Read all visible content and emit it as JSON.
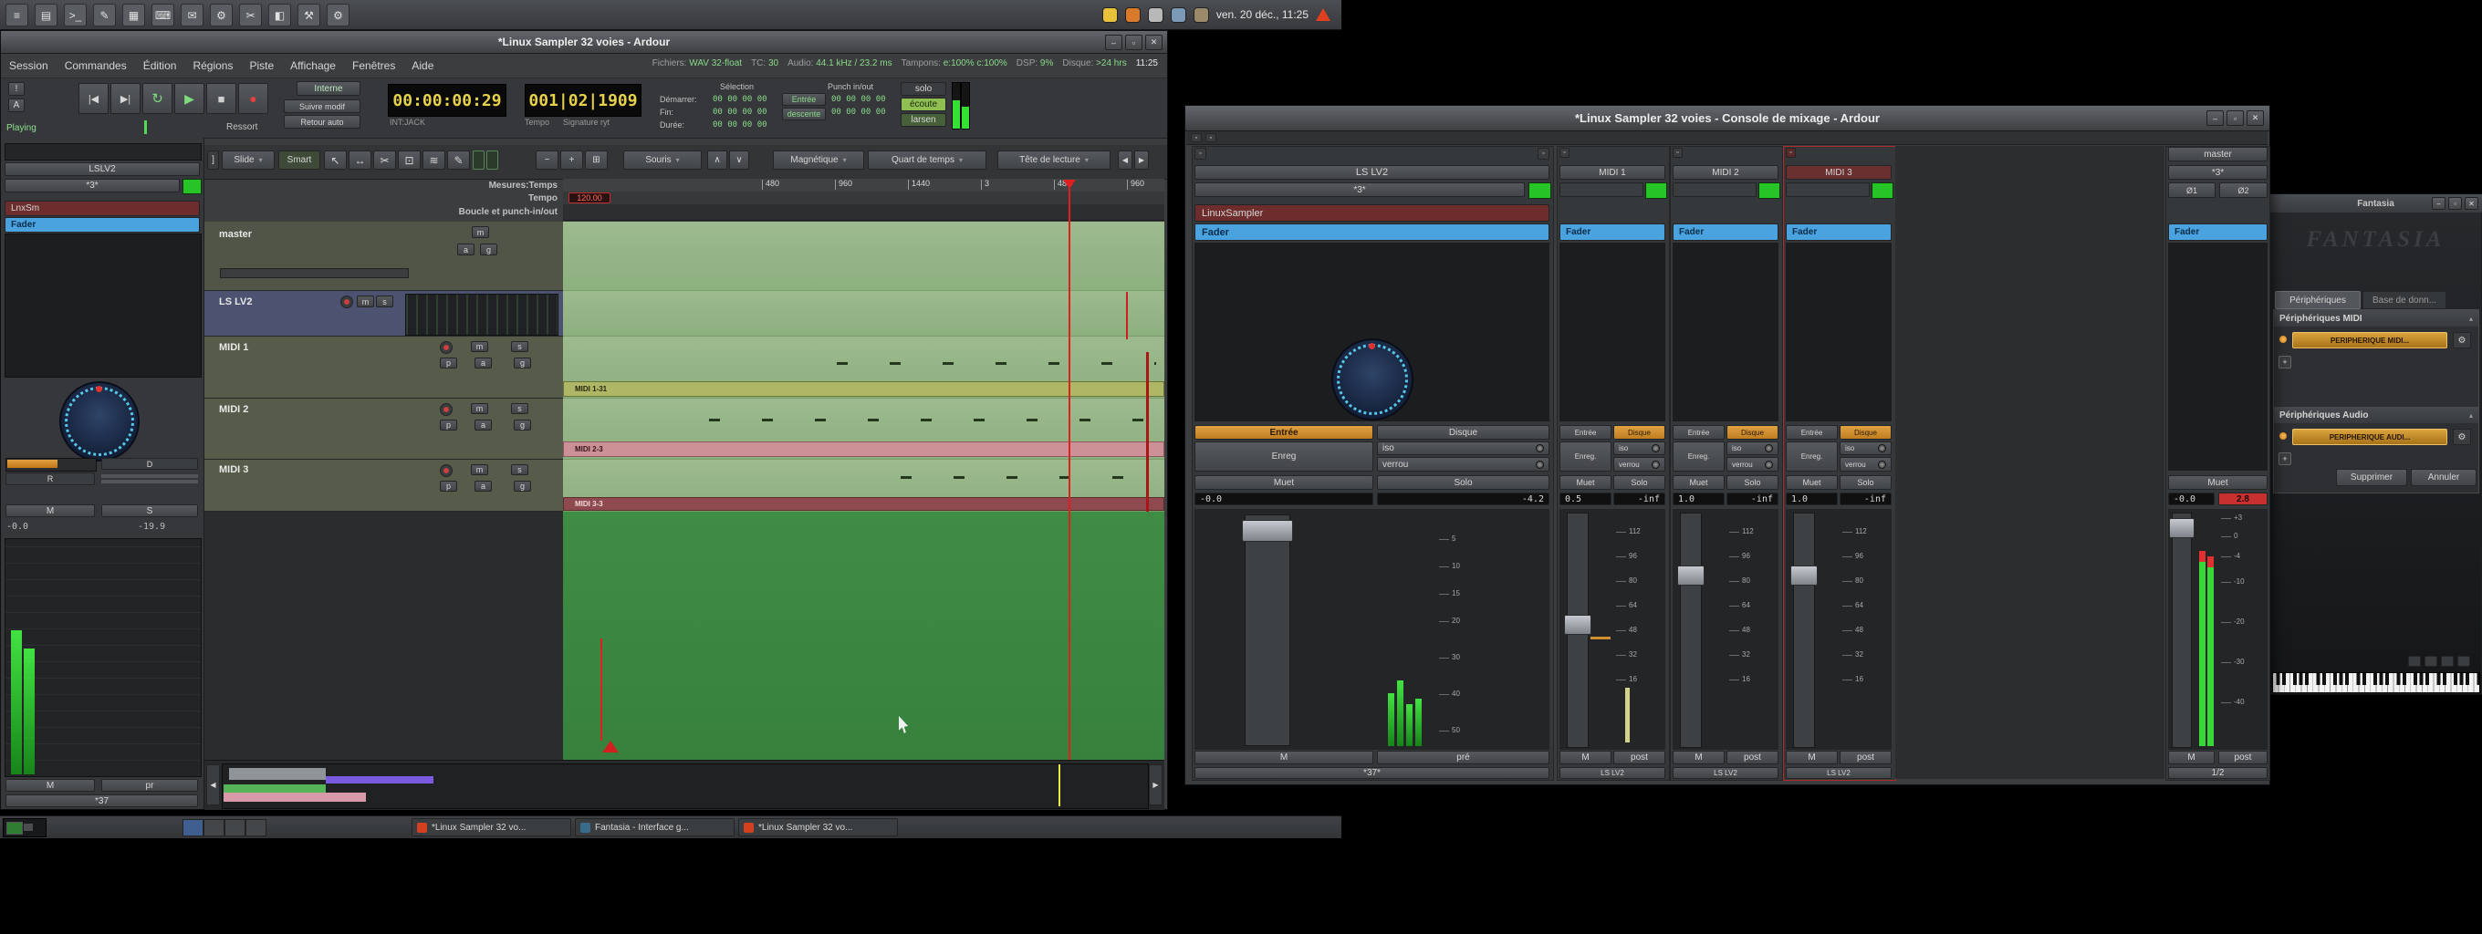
{
  "winctl": {
    "min": "–",
    "max": "▫",
    "close": "✕"
  },
  "panel": {
    "date": "ven. 20 déc., 11:25",
    "icons": [
      "≡",
      "▤",
      ">_",
      "✎",
      "▦",
      "⌨",
      "✉",
      "⚙",
      "✂",
      "◧",
      "⚒",
      "⚙"
    ]
  },
  "editor": {
    "title": "*Linux Sampler 32 voies - Ardour",
    "menus": [
      "Session",
      "Commandes",
      "Édition",
      "Régions",
      "Piste",
      "Affichage",
      "Fenêtres",
      "Aide"
    ],
    "info": {
      "files_label": "Fichiers:",
      "files_value": "WAV 32-float",
      "tc_label": "TC:",
      "tc_value": "30",
      "audio_label": "Audio:",
      "audio_value": "44.1 kHz / 23.2 ms",
      "buffers_label": "Tampons:",
      "buffers_value": "e:100% c:100%",
      "dsp_label": "DSP:",
      "dsp_value": "9%",
      "disk_label": "Disque:",
      "disk_value": ">24 hrs",
      "clock": "11:25"
    },
    "transport": {
      "alert": "!",
      "lock": "A",
      "icons": {
        "start": "|◀",
        "end": "▶|",
        "loop": "↻",
        "play": "▶",
        "stop": "■",
        "rec": "●"
      },
      "playing": "Playing",
      "spring": "Ressort",
      "sync": "Interne",
      "follow": "Suivre modif",
      "auto_return": "Retour auto",
      "main_clock": "00:00:00:29",
      "main_clock_sub": "INT:JACK",
      "secondary_clock": "001|02|1909",
      "tempo_label": "Tempo",
      "meter_label": "Signature ryt",
      "selection_header": "Sélection",
      "punch_header": "Punch in/out",
      "start_label": "Démarrer:",
      "end_label": "Fin:",
      "duration_label": "Durée:",
      "sel_start": "00 00 00 00",
      "sel_end": "00 00 00 00",
      "sel_duration": "00 00 00 00",
      "punch_in_val": "00 00 00 00",
      "punch_out_val": "00 00 00 00",
      "punch_in": "Entrée",
      "punch_out": "descente",
      "solo": "solo",
      "monitor": "écoute",
      "feedback": "larsen"
    },
    "toolbar": {
      "edge": "]",
      "slide": "Slide",
      "smart": "Smart",
      "tools": [
        "↖",
        "↔",
        "✂",
        "⊡",
        "≋",
        "✎"
      ],
      "zoom": [
        "−",
        "+",
        "⊞"
      ],
      "mouse": "Souris",
      "up": "∧",
      "down": "∨",
      "snap": "Magnétique",
      "grid": "Quart de temps",
      "edit_point": "Tête de lecture",
      "prev": "◀",
      "next": "▶"
    },
    "rulers": {
      "bars_label": "Mesures:Temps",
      "tempo_label": "Tempo",
      "loop_label": "Boucle et punch-in/out",
      "tempo_value": "120.00",
      "ticks": [
        "480",
        "960",
        "1440",
        "3",
        "480",
        "960"
      ]
    },
    "strip": {
      "name": "LSLV2",
      "input": "*3*",
      "proc1": "LnxSm",
      "proc2": "Fader",
      "pan_label": "D",
      "r": "R",
      "m": "M",
      "s": "S",
      "gain": "-0.0",
      "peak": "-19.9",
      "mute": "M",
      "pre": "pr",
      "output": "*37"
    },
    "tracks": {
      "master": "master",
      "lslv2": "LS LV2",
      "midi1": "MIDI 1",
      "midi2": "MIDI 2",
      "midi3": "MIDI 3",
      "m": "m",
      "s": "s",
      "a": "a",
      "g": "g",
      "p": "p"
    },
    "regions": {
      "r1": "MIDI 1-31",
      "r2": "MIDI 2-3",
      "r3": "MIDI 3-3"
    },
    "summary": {
      "left": "◀",
      "right": "▶"
    }
  },
  "mixer": {
    "title": "*Linux Sampler 32 voies - Console de mixage - Ardour",
    "mini": "▫",
    "ls": {
      "name": "LS LV2",
      "input": "*3*",
      "proc1": "LinuxSampler",
      "proc2": "Fader",
      "in_btn": "Entrée",
      "disk_btn": "Disque",
      "rec": "Enreg",
      "iso": "iso",
      "lock": "verrou",
      "mute": "Muet",
      "solo": "Solo",
      "gain": "-0.0",
      "peak": "-4.2",
      "m": "M",
      "pre": "pré",
      "output": "*37*",
      "scale": [
        "5",
        "10",
        "15",
        "20",
        "30",
        "40",
        "50"
      ]
    },
    "midi": {
      "fader": "Fader",
      "in_btn": "Entrée",
      "disk_btn": "Disque",
      "rec": "Enreg.",
      "iso": "iso",
      "lock": "verrou",
      "mute": "Muet",
      "solo": "Solo",
      "peak": "-inf",
      "m": "M",
      "post": "post",
      "output": "LS LV2",
      "scale": [
        "112",
        "96",
        "80",
        "64",
        "48",
        "32",
        "16"
      ]
    },
    "strips": [
      {
        "name": "MIDI 1",
        "gain": "0.5"
      },
      {
        "name": "MIDI 2",
        "gain": "1.0"
      },
      {
        "name": "MIDI 3",
        "gain": "1.0"
      }
    ],
    "master": {
      "name": "master",
      "input": "*3*",
      "phase1": "Ø1",
      "phase2": "Ø2",
      "fader": "Fader",
      "mute": "Muet",
      "gain": "-0.0",
      "peak": "2.8",
      "m": "M",
      "post": "post",
      "output": "1/2",
      "scale": [
        "+3",
        "0",
        "-4",
        "-10",
        "-20",
        "-30",
        "-40"
      ]
    }
  },
  "fantasia": {
    "title": "Fantasia",
    "logo": "FANTASIA",
    "tab1": "Périphériques",
    "tab2": "Base de donn...",
    "midi_header": "Périphériques MIDI",
    "midi_item": "PERIPHERIQUE MIDI...",
    "audio_header": "Périphériques Audio",
    "audio_item": "PERIPHERIQUE AUDI...",
    "delete_btn": "Supprimer",
    "cancel_btn": "Annuler",
    "gear": "⚙",
    "plus": "+",
    "collapse": "▴"
  },
  "taskbar": {
    "item1": "*Linux Sampler 32 vo...",
    "item2": "Fantasia - Interface g...",
    "item3": "*Linux Sampler 32 vo..."
  },
  "colors": {
    "accent_blue": "#4aa2de",
    "accent_orange": "#d18f2f",
    "canvas_green": "#95b687",
    "deep_green": "#3c8742",
    "meter_green": "#3ddc3d",
    "clock_yellow": "#e6d14b",
    "alert_red": "#cc2222"
  }
}
